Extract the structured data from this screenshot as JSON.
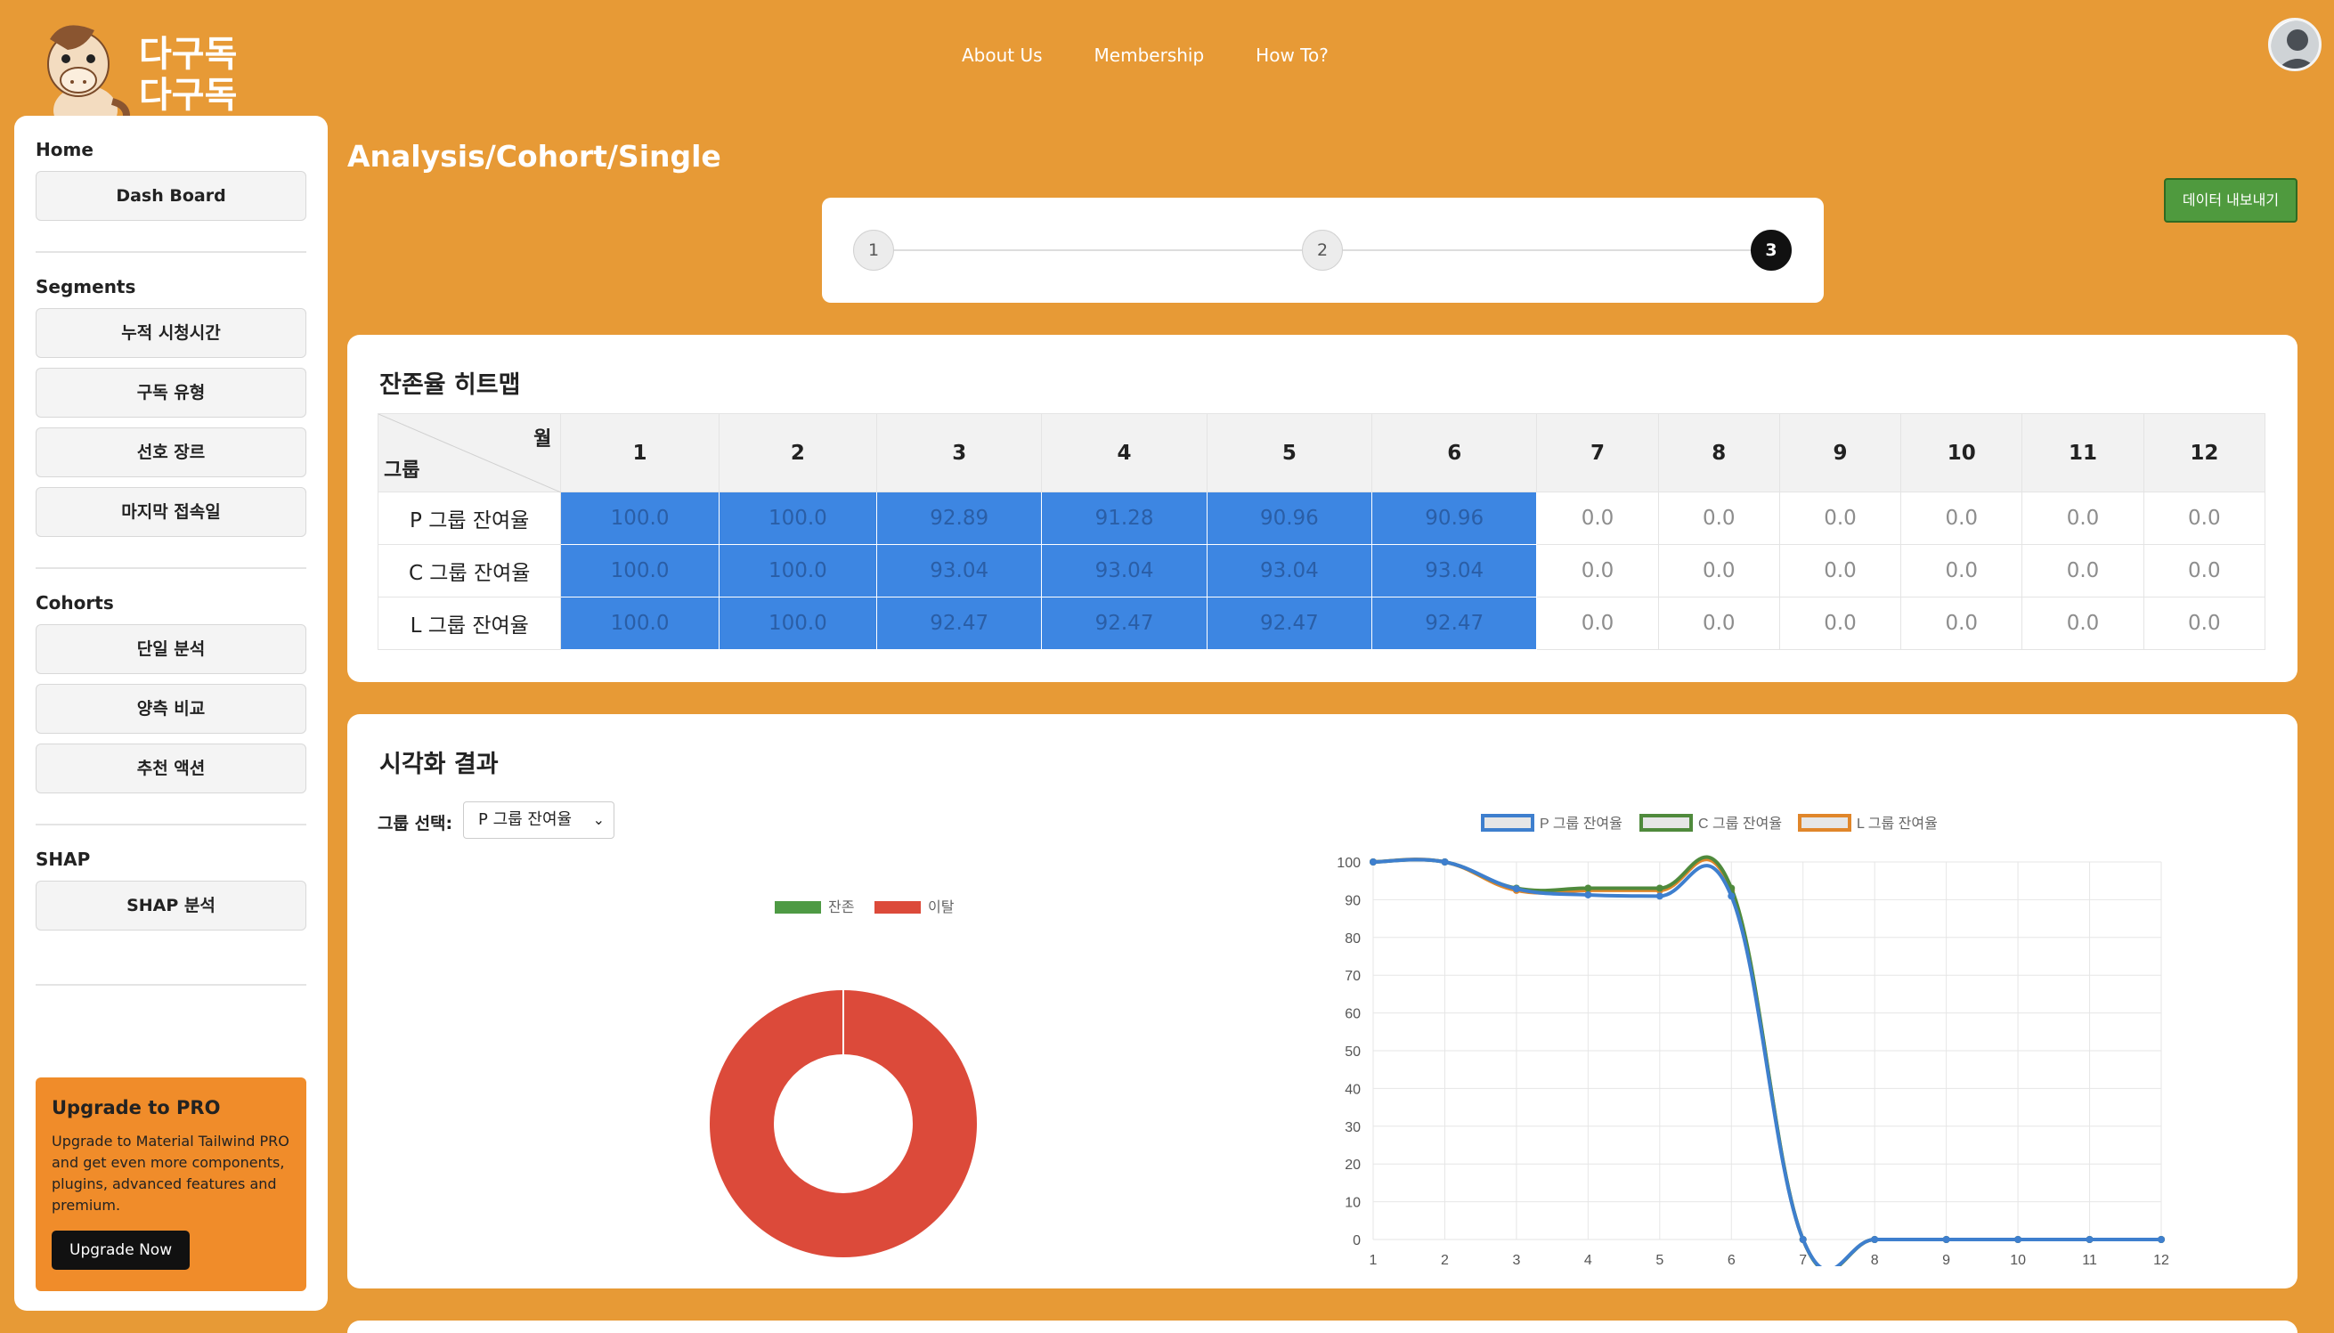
{
  "brand": {
    "line1": "다구독",
    "line2": "다구독"
  },
  "nav": {
    "about": "About Us",
    "membership": "Membership",
    "howto": "How To?"
  },
  "sidebar": {
    "home_title": "Home",
    "dashboard": "Dash Board",
    "segments_title": "Segments",
    "segments": [
      "누적 시청시간",
      "구독 유형",
      "선호 장르",
      "마지막 접속일"
    ],
    "cohorts_title": "Cohorts",
    "cohorts": [
      "단일 분석",
      "양측 비교",
      "추천 액션"
    ],
    "shap_title": "SHAP",
    "shap": "SHAP 분석",
    "upgrade": {
      "title": "Upgrade to PRO",
      "text": "Upgrade to Material Tailwind PRO and get even more components, plugins, advanced features and premium.",
      "button": "Upgrade Now"
    }
  },
  "page_title": "Analysis/Cohort/Single",
  "stepper": {
    "steps": [
      "1",
      "2",
      "3"
    ],
    "active": 3
  },
  "export_button": "데이터 내보내기",
  "heatmap": {
    "title": "잔존율 히트맵",
    "corner_top": "월",
    "corner_bottom": "그룹",
    "months": [
      "1",
      "2",
      "3",
      "4",
      "5",
      "6",
      "7",
      "8",
      "9",
      "10",
      "11",
      "12"
    ],
    "rows": [
      {
        "label": "P 그룹 잔여율",
        "values": [
          "100.0",
          "100.0",
          "92.89",
          "91.28",
          "90.96",
          "90.96",
          "0.0",
          "0.0",
          "0.0",
          "0.0",
          "0.0",
          "0.0"
        ]
      },
      {
        "label": "C 그룹 잔여율",
        "values": [
          "100.0",
          "100.0",
          "93.04",
          "93.04",
          "93.04",
          "93.04",
          "0.0",
          "0.0",
          "0.0",
          "0.0",
          "0.0",
          "0.0"
        ]
      },
      {
        "label": "L 그룹 잔여율",
        "values": [
          "100.0",
          "100.0",
          "92.47",
          "92.47",
          "92.47",
          "92.47",
          "0.0",
          "0.0",
          "0.0",
          "0.0",
          "0.0",
          "0.0"
        ]
      }
    ],
    "highlight_color": "#3d86e2"
  },
  "viz": {
    "title": "시각화 결과",
    "select_label": "그룹 선택:",
    "select_value": "P 그룹 잔여율"
  },
  "chart_data": [
    {
      "type": "pie",
      "variant": "doughnut",
      "categories": [
        "잔존",
        "이탈"
      ],
      "values": [
        0,
        100
      ],
      "colors": [
        "#4e9a44",
        "#dc4a3a"
      ],
      "legend": "top"
    },
    {
      "type": "line",
      "x": [
        1,
        2,
        3,
        4,
        5,
        6,
        7,
        8,
        9,
        10,
        11,
        12
      ],
      "series": [
        {
          "name": "P 그룹 잔여율",
          "values": [
            100,
            100,
            92.89,
            91.28,
            90.96,
            90.96,
            0,
            0,
            0,
            0,
            0,
            0
          ],
          "color": "#3e7fce"
        },
        {
          "name": "C 그룹 잔여율",
          "values": [
            100,
            100,
            93.04,
            93.04,
            93.04,
            93.04,
            0,
            0,
            0,
            0,
            0,
            0
          ],
          "color": "#4f8a3c"
        },
        {
          "name": "L 그룹 잔여율",
          "values": [
            100,
            100,
            92.47,
            92.47,
            92.47,
            92.47,
            0,
            0,
            0,
            0,
            0,
            0
          ],
          "color": "#e0862a"
        }
      ],
      "ylim": [
        0,
        100
      ],
      "yticks": [
        0,
        10,
        20,
        30,
        40,
        50,
        60,
        70,
        80,
        90,
        100
      ],
      "grid": true,
      "legend": "top"
    }
  ]
}
